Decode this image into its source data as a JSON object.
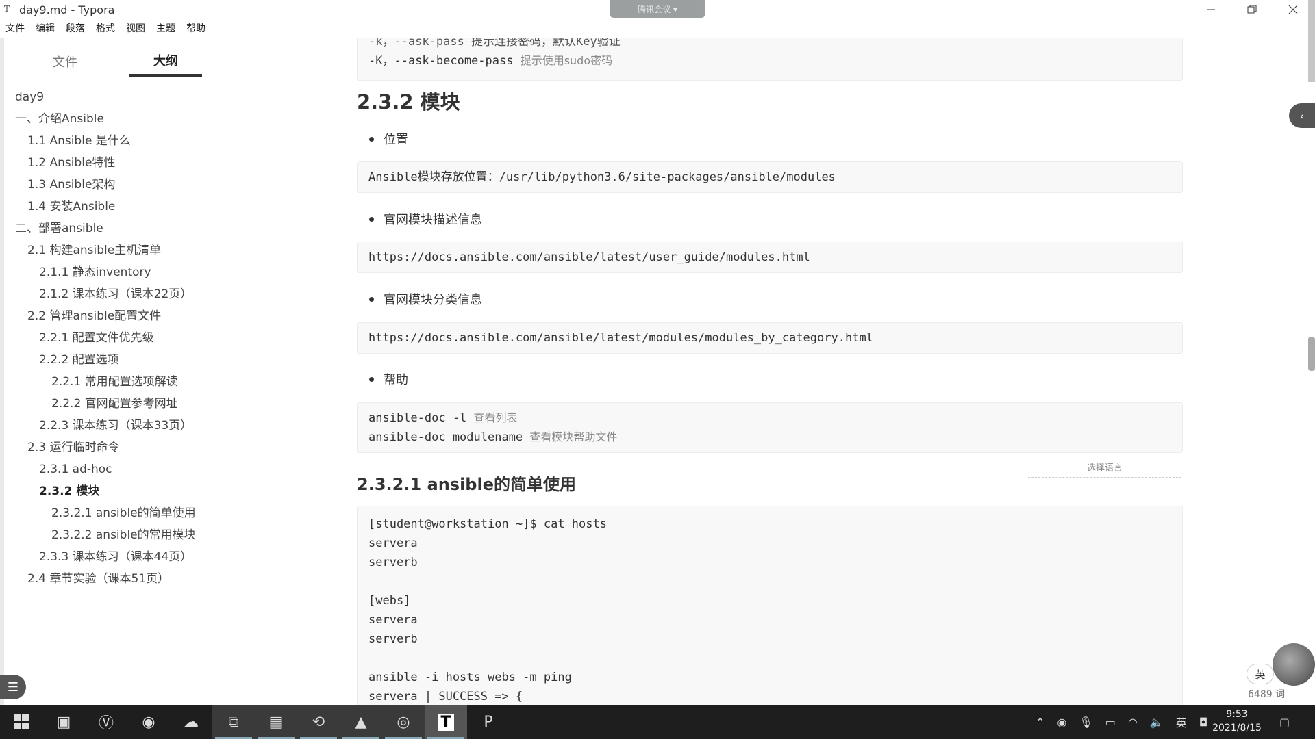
{
  "window": {
    "title": "day9.md - Typora",
    "meeting_badge": "腾讯会议 ▾"
  },
  "menu": [
    "文件",
    "编辑",
    "段落",
    "格式",
    "视图",
    "主题",
    "帮助"
  ],
  "sidebar": {
    "tabs": [
      "文件",
      "大纲"
    ],
    "active_tab": "大纲",
    "outline": [
      {
        "label": "day9",
        "level": 0
      },
      {
        "label": "一、介绍Ansible",
        "level": 1
      },
      {
        "label": "1.1 Ansible 是什么",
        "level": 2
      },
      {
        "label": "1.2 Ansible特性",
        "level": 2
      },
      {
        "label": "1.3 Ansible架构",
        "level": 2
      },
      {
        "label": "1.4 安装Ansible",
        "level": 2
      },
      {
        "label": "二、部署ansible",
        "level": 1
      },
      {
        "label": "2.1 构建ansible主机清单",
        "level": 2
      },
      {
        "label": "2.1.1 静态inventory",
        "level": 3
      },
      {
        "label": "2.1.2 课本练习（课本22页）",
        "level": 3
      },
      {
        "label": "2.2 管理ansible配置文件",
        "level": 2
      },
      {
        "label": "2.2.1 配置文件优先级",
        "level": 3
      },
      {
        "label": "2.2.2 配置选项",
        "level": 3
      },
      {
        "label": "2.2.1 常用配置选项解读",
        "level": 4
      },
      {
        "label": "2.2.2 官网配置参考网址",
        "level": 4
      },
      {
        "label": "2.2.3 课本练习（课本33页）",
        "level": 3
      },
      {
        "label": "2.3 运行临时命令",
        "level": 2
      },
      {
        "label": "2.3.1 ad-hoc",
        "level": 3
      },
      {
        "label": "2.3.2 模块",
        "level": 3,
        "active": true
      },
      {
        "label": "2.3.2.1 ansible的简单使用",
        "level": 4
      },
      {
        "label": "2.3.2.2 ansible的常用模块",
        "level": 4
      },
      {
        "label": "2.3.3 课本练习（课本44页）",
        "level": 3
      },
      {
        "label": "2.4 章节实验（课本51页）",
        "level": 2
      }
    ],
    "footer_prev": "‹",
    "footer_source": "</>"
  },
  "content": {
    "top_code": {
      "line1": "-k，--ask-pass 提示连接密码，默认Key验证",
      "line2_cmd": "-K，--ask-become-pass ",
      "line2_comment": "提示使用sudo密码"
    },
    "heading_modules": "2.3.2 模块",
    "bullet_location": "位置",
    "code_location": "Ansible模块存放位置：/usr/lib/python3.6/site-packages/ansible/modules",
    "bullet_desc": "官网模块描述信息",
    "code_desc": "https://docs.ansible.com/ansible/latest/user_guide/modules.html",
    "bullet_category": "官网模块分类信息",
    "code_category": "https://docs.ansible.com/ansible/latest/modules/modules_by_category.html",
    "bullet_help": "帮助",
    "help_code": {
      "line1_cmd": "ansible-doc -l ",
      "line1_comment": "查看列表",
      "line2_cmd": "ansible-doc modulename ",
      "line2_comment": "查看模块帮助文件"
    },
    "lang_select": "选择语言",
    "heading_simple": "2.3.2.1 ansible的简单使用",
    "hosts_code": [
      "[student@workstation ~]$ cat hosts",
      "servera",
      "serverb",
      "",
      "[webs]",
      "servera",
      "serverb",
      "",
      "ansible -i hosts webs -m ping",
      "servera | SUCCESS => {"
    ]
  },
  "status": {
    "ime": "英",
    "word_count": "6489 词"
  },
  "taskbar": {
    "tray_lang": "英",
    "time": "9:53",
    "date": "2021/8/15"
  }
}
